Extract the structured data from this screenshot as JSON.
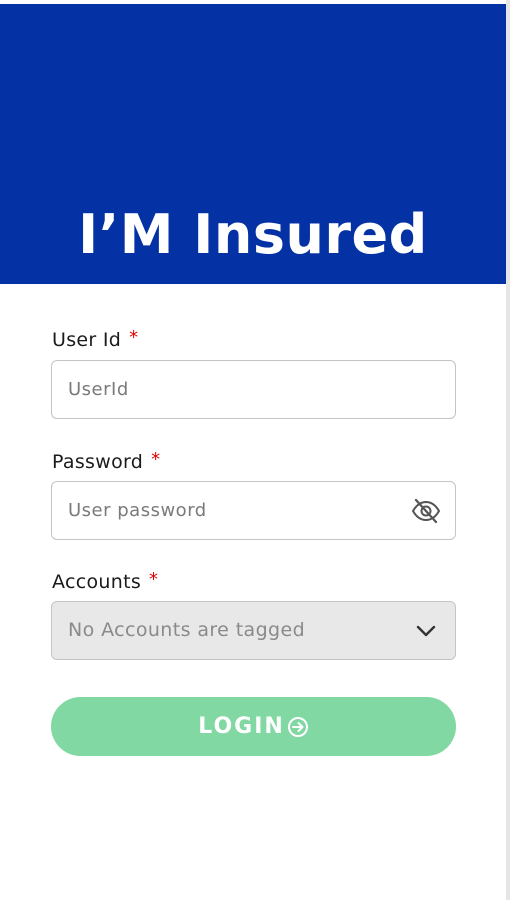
{
  "app": {
    "title": "I’M Insured"
  },
  "form": {
    "user_id": {
      "label": "User Id",
      "required_mark": "*",
      "placeholder": "UserId",
      "value": ""
    },
    "password": {
      "label": "Password",
      "required_mark": "*",
      "placeholder": "User password",
      "value": "",
      "toggle_icon": "eye-slash-icon"
    },
    "accounts": {
      "label": "Accounts",
      "required_mark": "*",
      "selected": "No Accounts are tagged",
      "disabled": true,
      "dropdown_icon": "chevron-down-icon"
    },
    "login_button": {
      "label": "LOGIN",
      "icon": "arrow-right-circle-icon"
    }
  },
  "colors": {
    "header_bg": "#0431a3",
    "login_button_bg": "#81d8a2",
    "required_mark": "#e00000",
    "select_disabled_bg": "#e8e8e8"
  }
}
